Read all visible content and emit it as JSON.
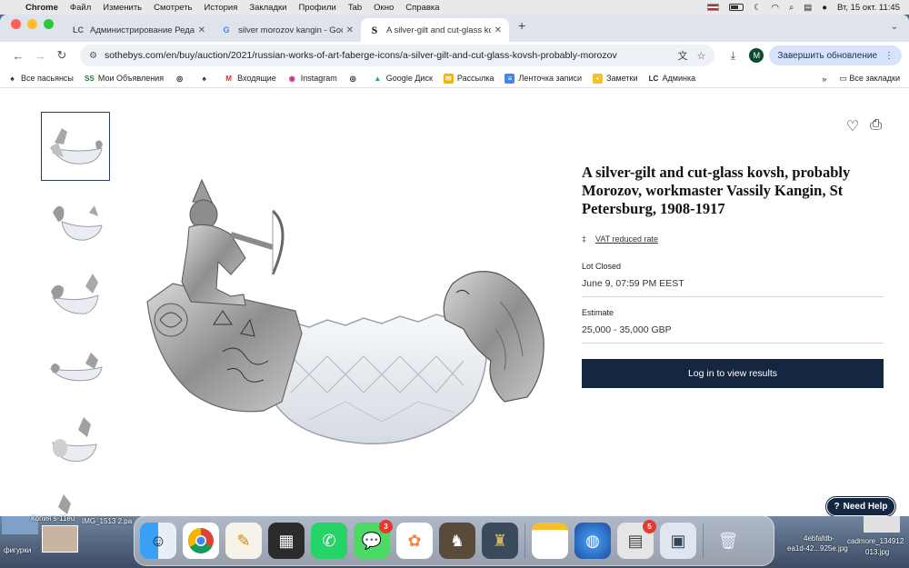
{
  "menubar": {
    "app_name": "Chrome",
    "items": [
      "Файл",
      "Изменить",
      "Смотреть",
      "История",
      "Закладки",
      "Профили",
      "Tab",
      "Окно",
      "Справка"
    ],
    "datetime": "Вт, 15 окт.  11:45"
  },
  "tabs": [
    {
      "favicon": "LC",
      "title": "Администрирование Редакт"
    },
    {
      "favicon": "G",
      "title": "silver morozov kangin - Goog"
    },
    {
      "favicon": "S",
      "title": "A silver-gilt and cut-glass kov"
    }
  ],
  "toolbar": {
    "url": "sothebys.com/en/buy/auction/2021/russian-works-of-art-faberge-icons/a-silver-gilt-and-cut-glass-kovsh-probably-morozov",
    "profile_initial": "M",
    "update_label": "Завершить обновление"
  },
  "bookmarks": {
    "items": [
      {
        "icon": "♠",
        "label": "Все пасьянсы"
      },
      {
        "icon": "SS",
        "label": "Мои Объявления"
      },
      {
        "icon": "◎",
        "label": ""
      },
      {
        "icon": "♠",
        "label": ""
      },
      {
        "icon": "M",
        "label": "Входящие"
      },
      {
        "icon": "◉",
        "label": "Instagram"
      },
      {
        "icon": "◎",
        "label": ""
      },
      {
        "icon": "▲",
        "label": "Google Диск"
      },
      {
        "icon": "✉",
        "label": "Рассылка"
      },
      {
        "icon": "≡",
        "label": "Ленточка записи"
      },
      {
        "icon": "▪",
        "label": "Заметки"
      },
      {
        "icon": "LC",
        "label": "Админка"
      }
    ],
    "more": "»",
    "all_label": "Все закладки"
  },
  "lot": {
    "title": "A silver-gilt and cut-glass kovsh, probably Morozov, workmaster Vassily Kangin, St Petersburg, 1908-1917",
    "vat_label": "VAT reduced rate",
    "lot_closed_label": "Lot Closed",
    "lot_closed_value": "June 9, 07:59 PM EEST",
    "estimate_label": "Estimate",
    "estimate_value": "25,000 - 35,000 GBP",
    "login_button": "Log in to view results",
    "help_button": "Need Help"
  },
  "desktop": {
    "files": [
      "Копия s-11eu",
      "IMG_1513 2.ра",
      "фигурки",
      "4ebfafdb-",
      "ea1d-42...925e.jpg",
      "cadmore_134912",
      "013.jpg"
    ]
  },
  "dock": {
    "badges": {
      "messages": "3",
      "mail_preview": "5"
    }
  },
  "colors": {
    "brand_navy": "#152740",
    "selected_thumb_border": "#2d3e6e"
  }
}
